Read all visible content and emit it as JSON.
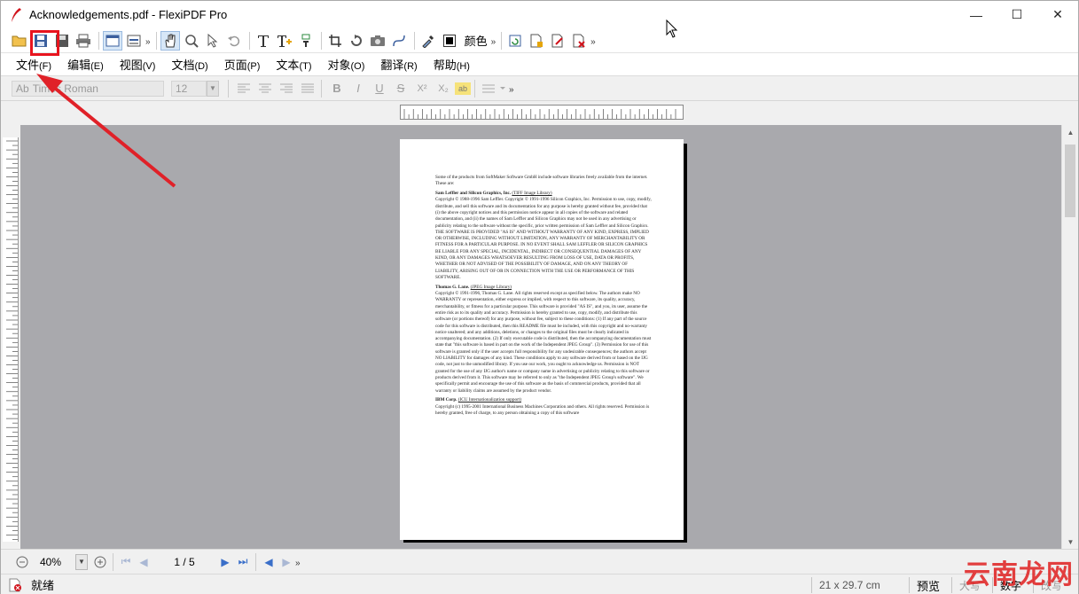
{
  "window": {
    "title": "Acknowledgements.pdf - FlexiPDF Pro",
    "minimize": "—",
    "maximize": "☐",
    "close": "✕"
  },
  "toolbar": {
    "color_label": "颜色",
    "more": "»",
    "accent": "#e8141e"
  },
  "menu": [
    {
      "label": "文件",
      "hotkey": "(F)"
    },
    {
      "label": "编辑",
      "hotkey": "(E)"
    },
    {
      "label": "视图",
      "hotkey": "(V)"
    },
    {
      "label": "文档",
      "hotkey": "(D)"
    },
    {
      "label": "页面",
      "hotkey": "(P)"
    },
    {
      "label": "文本",
      "hotkey": "(T)"
    },
    {
      "label": "对象",
      "hotkey": "(O)"
    },
    {
      "label": "翻译",
      "hotkey": "(R)"
    },
    {
      "label": "帮助",
      "hotkey": "(H)"
    }
  ],
  "format": {
    "font_icon": "Ab",
    "font_name": "Times Roman",
    "font_size": "12",
    "bold": "B",
    "italic": "I",
    "underline": "U",
    "strike": "S",
    "superscript": "X²",
    "subscript": "X₂",
    "highlight": "ab"
  },
  "document": {
    "intro": "Some of the products from SoftMaker Software GmbH include software libraries freely available from the internet. These are:",
    "s1_head": "Sam Leffler and Silicon Graphics, Inc.",
    "s1_tag": "(TIFF Image Library)",
    "s1_body": "Copyright © 1988-1996 Sam Leffler. Copyright © 1991-1996 Silicon Graphics, Inc. Permission to use, copy, modify, distribute, and sell this software and its documentation for any purpose is hereby granted without fee, provided that (i) the above copyright notices and this permission notice appear in all copies of the software and related documentation, and (ii) the names of Sam Leffler and Silicon Graphics may not be used in any advertising or publicity relating to the software without the specific, prior written permission of Sam Leffler and Silicon Graphics.",
    "s1_caps": "THE SOFTWARE IS PROVIDED \"AS IS\" AND WITHOUT WARRANTY OF ANY KIND, EXPRESS, IMPLIED OR OTHERWISE, INCLUDING WITHOUT LIMITATION, ANY WARRANTY OF MERCHANTABILITY OR FITNESS FOR A PARTICULAR PURPOSE. IN NO EVENT SHALL SAM LEFFLER OR SILICON GRAPHICS BE LIABLE FOR ANY SPECIAL, INCIDENTAL, INDIRECT OR CONSEQUENTIAL DAMAGES OF ANY KIND, OR ANY DAMAGES WHATSOEVER RESULTING FROM LOSS OF USE, DATA OR PROFITS, WHETHER OR NOT ADVISED OF THE POSSIBILITY OF DAMAGE, AND ON ANY THEORY OF LIABILITY, ARISING OUT OF OR IN CONNECTION WITH THE USE OR PERFORMANCE OF THIS SOFTWARE.",
    "s2_head": "Thomas G. Lane.",
    "s2_tag": "(JPEG Image Library)",
    "s2_body": "Copyright © 1991-1996, Thomas G. Lane. All rights reserved except as specified below. The authors make NO WARRANTY or representation, either express or implied, with respect to this software, its quality, accuracy, merchantability, or fitness for a particular purpose. This software is provided \"AS IS\", and you, its user, assume the entire risk as to its quality and accuracy. Permission is hereby granted to use, copy, modify, and distribute this software (or portions thereof) for any purpose, without fee, subject to these conditions: (1) If any part of the source code for this software is distributed, then this README file must be included, with this copyright and no-warranty notice unaltered; and any additions, deletions, or changes to the original files must be clearly indicated in accompanying documentation. (2) If only executable code is distributed, then the accompanying documentation must state that \"this software is based in part on the work of the Independent JPEG Group\". (3) Permission for use of this software is granted only if the user accepts full responsibility for any undesirable consequences; the authors accept NO LIABILITY for damages of any kind. These conditions apply to any software derived from or based on the IJG code, not just to the unmodified library. If you use our work, you ought to acknowledge us. Permission is NOT granted for the use of any IJG author's name or company name in advertising or publicity relating to this software or products derived from it. This software may be referred to only as \"the Independent JPEG Group's software\". We specifically permit and encourage the use of this software as the basis of commercial products, provided that all warranty or liability claims are assumed by the product vendor.",
    "s3_head": "IBM Corp.",
    "s3_tag": "(ICU Internationalization support)",
    "s3_body": "Copyright (c) 1995-2001 International Business Machines Corporation and others. All rights reserved. Permission is hereby granted, free of charge, to any person obtaining a copy of this software"
  },
  "navigation": {
    "zoom": "40%",
    "page": "1 / 5",
    "more": "»"
  },
  "status": {
    "text": "就绪",
    "page_size": "21 x 29.7 cm",
    "mode": "预览",
    "caps": "大写",
    "num": "数字",
    "ovr": "改写"
  },
  "watermark": "云南龙网"
}
